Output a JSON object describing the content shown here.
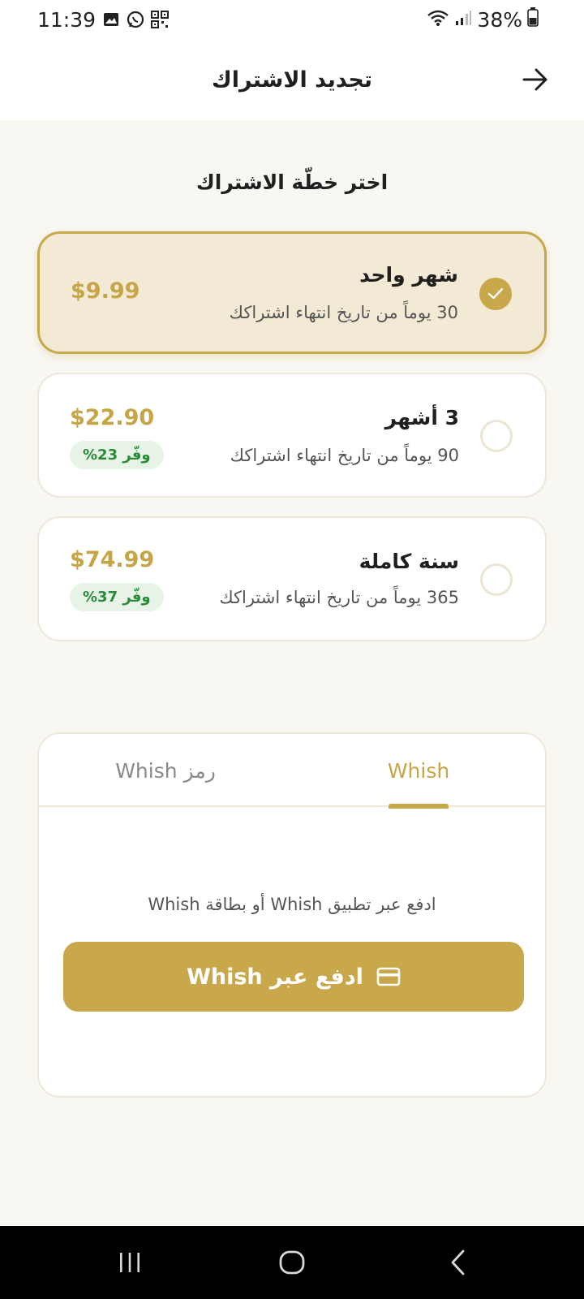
{
  "status_bar": {
    "time": "11:39",
    "battery": "38%",
    "icons": [
      "image-icon",
      "whatsapp-icon",
      "qr-icon",
      "wifi-icon",
      "signal-icon",
      "battery-icon"
    ]
  },
  "header": {
    "title": "تجديد الاشتراك",
    "back_icon": "arrow-right-icon"
  },
  "plans_heading": "اختر خطّة الاشتراك",
  "plans": [
    {
      "name": "شهر واحد",
      "duration": "30 يوماً من تاريخ انتهاء اشتراكك",
      "price": "$9.99",
      "badge": "",
      "selected": true
    },
    {
      "name": "3 أشهر",
      "duration": "90 يوماً من تاريخ انتهاء اشتراكك",
      "price": "$22.90",
      "badge": "وفّر 23%",
      "selected": false
    },
    {
      "name": "سنة كاملة",
      "duration": "365 يوماً من تاريخ انتهاء اشتراكك",
      "price": "$74.99",
      "badge": "وفّر 37%",
      "selected": false
    }
  ],
  "payment": {
    "tabs": [
      {
        "label": "Whish",
        "active": true
      },
      {
        "label": "رمز Whish",
        "active": false
      }
    ],
    "hint": "ادفع عبر تطبيق Whish أو بطاقة Whish",
    "button_label": "ادفع عبر Whish",
    "button_icon": "credit-card-icon"
  },
  "nav_bar": {
    "buttons": [
      "recent-apps-icon",
      "home-icon",
      "back-icon"
    ]
  },
  "colors": {
    "accent": "#c9a84b",
    "price": "#c5a545",
    "selected_bg": "#f3ead5",
    "badge_bg": "#e6f3e6",
    "badge_text": "#2a8a3a",
    "page_bg": "#f8f7f2"
  }
}
